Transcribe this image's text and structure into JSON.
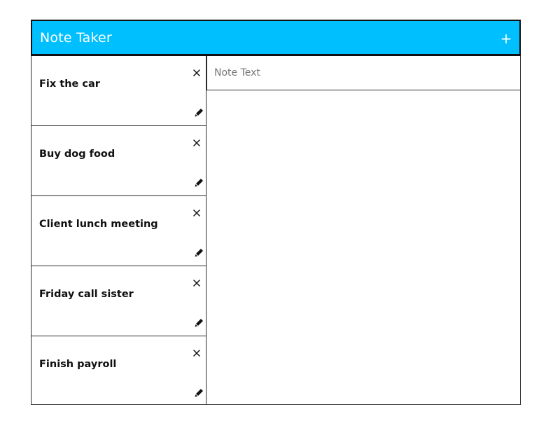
{
  "header": {
    "title": "Note Taker",
    "add_label": "+"
  },
  "notes": [
    {
      "title": "Fix the car"
    },
    {
      "title": "Buy dog food"
    },
    {
      "title": "Client lunch meeting"
    },
    {
      "title": "Friday call sister"
    },
    {
      "title": "Finish payroll"
    }
  ],
  "editor": {
    "note_text_value": "",
    "note_text_placeholder": "Note Text"
  },
  "icons": {
    "delete": "close-icon",
    "edit": "pencil-icon",
    "add": "plus-icon"
  },
  "colors": {
    "header_background": "#00bfff",
    "header_text": "#ffffff",
    "border": "#2b2b2b"
  }
}
